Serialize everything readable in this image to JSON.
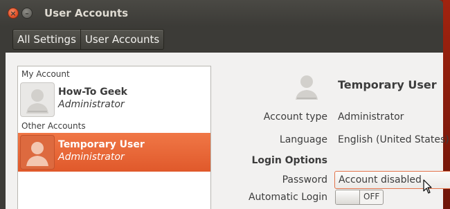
{
  "window": {
    "title": "User Accounts",
    "controls": [
      {
        "name": "close",
        "glyph": "×"
      },
      {
        "name": "minimize",
        "glyph": "–"
      }
    ]
  },
  "breadcrumb": {
    "items": [
      "All Settings",
      "User Accounts"
    ]
  },
  "account_list": {
    "sections": [
      {
        "label": "My Account",
        "accounts": [
          {
            "name": "How-To Geek",
            "role": "Administrator",
            "selected": false
          }
        ]
      },
      {
        "label": "Other Accounts",
        "accounts": [
          {
            "name": "Temporary User",
            "role": "Administrator",
            "selected": true
          }
        ]
      }
    ]
  },
  "details": {
    "name": "Temporary User",
    "account_type_label": "Account type",
    "account_type_value": "Administrator",
    "language_label": "Language",
    "language_value": "English (United States)",
    "login_options_heading": "Login Options",
    "password_label": "Password",
    "password_value": "Account disabled",
    "auto_login_label": "Automatic Login",
    "auto_login_state": "OFF"
  },
  "colors": {
    "titlebar": "#3c3b37",
    "accent": "#e0592b",
    "content_bg": "#f2f1f0",
    "desktop": "#8a1e0c"
  }
}
